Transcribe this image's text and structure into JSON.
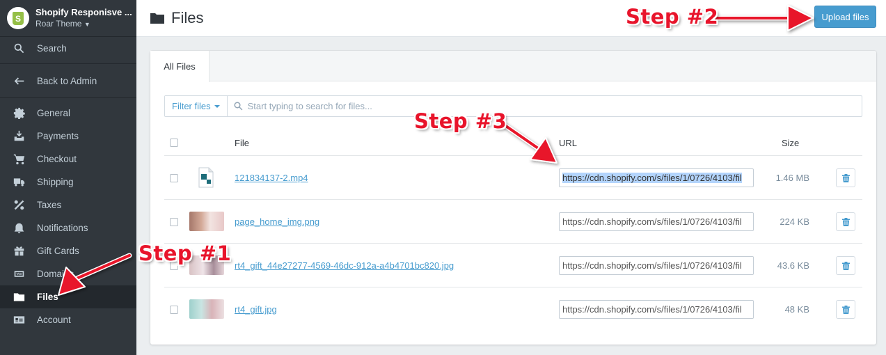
{
  "sidebar": {
    "store_name": "Shopify Responisve ...",
    "theme": "Roar Theme",
    "items": [
      {
        "label": "Search",
        "icon": "search-icon"
      },
      {
        "label": "Back to Admin",
        "icon": "arrow-left-icon"
      },
      {
        "label": "General",
        "icon": "gear-icon"
      },
      {
        "label": "Payments",
        "icon": "payments-icon"
      },
      {
        "label": "Checkout",
        "icon": "cart-icon"
      },
      {
        "label": "Shipping",
        "icon": "truck-icon"
      },
      {
        "label": "Taxes",
        "icon": "percent-icon"
      },
      {
        "label": "Notifications",
        "icon": "bell-icon"
      },
      {
        "label": "Gift Cards",
        "icon": "gift-icon"
      },
      {
        "label": "Domains",
        "icon": "www-icon"
      },
      {
        "label": "Files",
        "icon": "folder-icon",
        "active": true
      },
      {
        "label": "Account",
        "icon": "id-card-icon"
      }
    ]
  },
  "header": {
    "title": "Files",
    "upload_label": "Upload files"
  },
  "tabs": [
    {
      "label": "All Files"
    }
  ],
  "filter": {
    "label": "Filter files",
    "placeholder": "Start typing to search for files..."
  },
  "table": {
    "columns": {
      "file": "File",
      "url": "URL",
      "size": "Size"
    },
    "rows": [
      {
        "name": "121834137-2.mp4",
        "url": "https://cdn.shopify.com/s/files/1/0726/4103/fil",
        "size": "1.46 MB",
        "selected": true
      },
      {
        "name": "page_home_img.png",
        "url": "https://cdn.shopify.com/s/files/1/0726/4103/fil",
        "size": "224 KB"
      },
      {
        "name": "rt4_gift_44e27277-4569-46dc-912a-a4b4701bc820.jpg",
        "url": "https://cdn.shopify.com/s/files/1/0726/4103/fil",
        "size": "43.6 KB"
      },
      {
        "name": "rt4_gift.jpg",
        "url": "https://cdn.shopify.com/s/files/1/0726/4103/fil",
        "size": "48 KB"
      }
    ]
  },
  "annotations": {
    "step1": "Step #1",
    "step2": "Step #2",
    "step3": "Step #3"
  },
  "colors": {
    "sidebar_bg": "#31373d",
    "accent": "#479ccf",
    "annotation": "#e8142b"
  }
}
